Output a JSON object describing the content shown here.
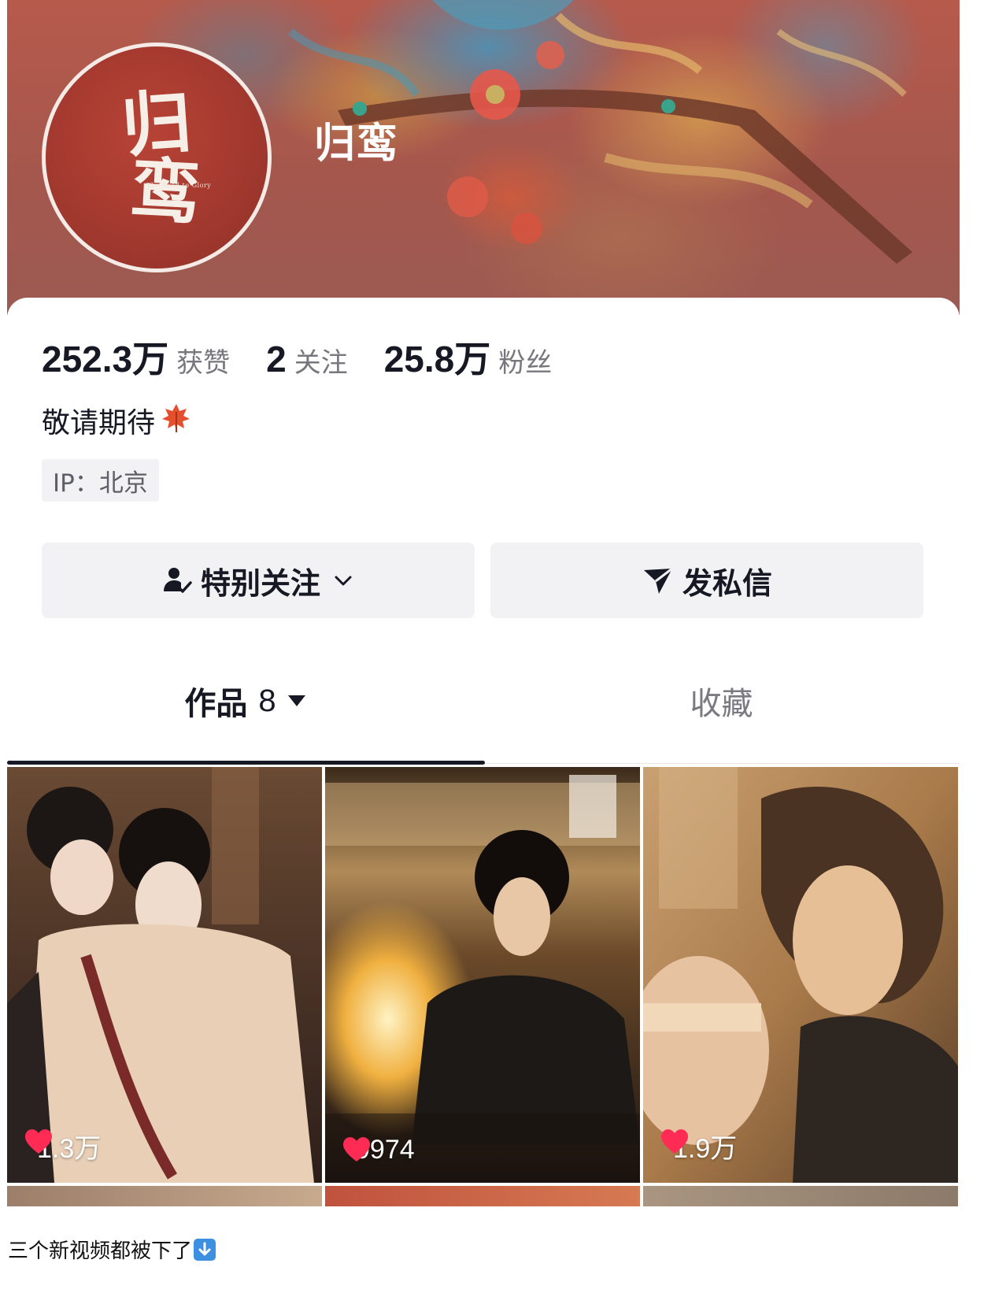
{
  "profile": {
    "name": "归鸾",
    "avatar_text_line1": "归",
    "avatar_text_line2": "鸾",
    "avatar_subtitle": "The Road to Glory",
    "bio": "敬请期待",
    "ip_label": "IP：北京"
  },
  "stats": [
    {
      "value": "252.3万",
      "label": "获赞"
    },
    {
      "value": "2",
      "label": "关注"
    },
    {
      "value": "25.8万",
      "label": "粉丝"
    }
  ],
  "actions": {
    "follow_label": "特别关注",
    "follow_icon": "user-check-icon",
    "message_label": "发私信",
    "message_icon": "paper-plane-icon"
  },
  "tabs": {
    "works_label": "作品",
    "works_count": "8",
    "favorites_label": "收藏"
  },
  "videos": [
    {
      "likes": "1.3万"
    },
    {
      "likes": "9974"
    },
    {
      "likes": "1.9万"
    }
  ],
  "caption": "三个新视频都被下了",
  "colors": {
    "like_heart": "#fe2c55",
    "banner_base": "#a4574d",
    "avatar_red": "#a3392f",
    "button_bg": "#f2f2f4"
  }
}
